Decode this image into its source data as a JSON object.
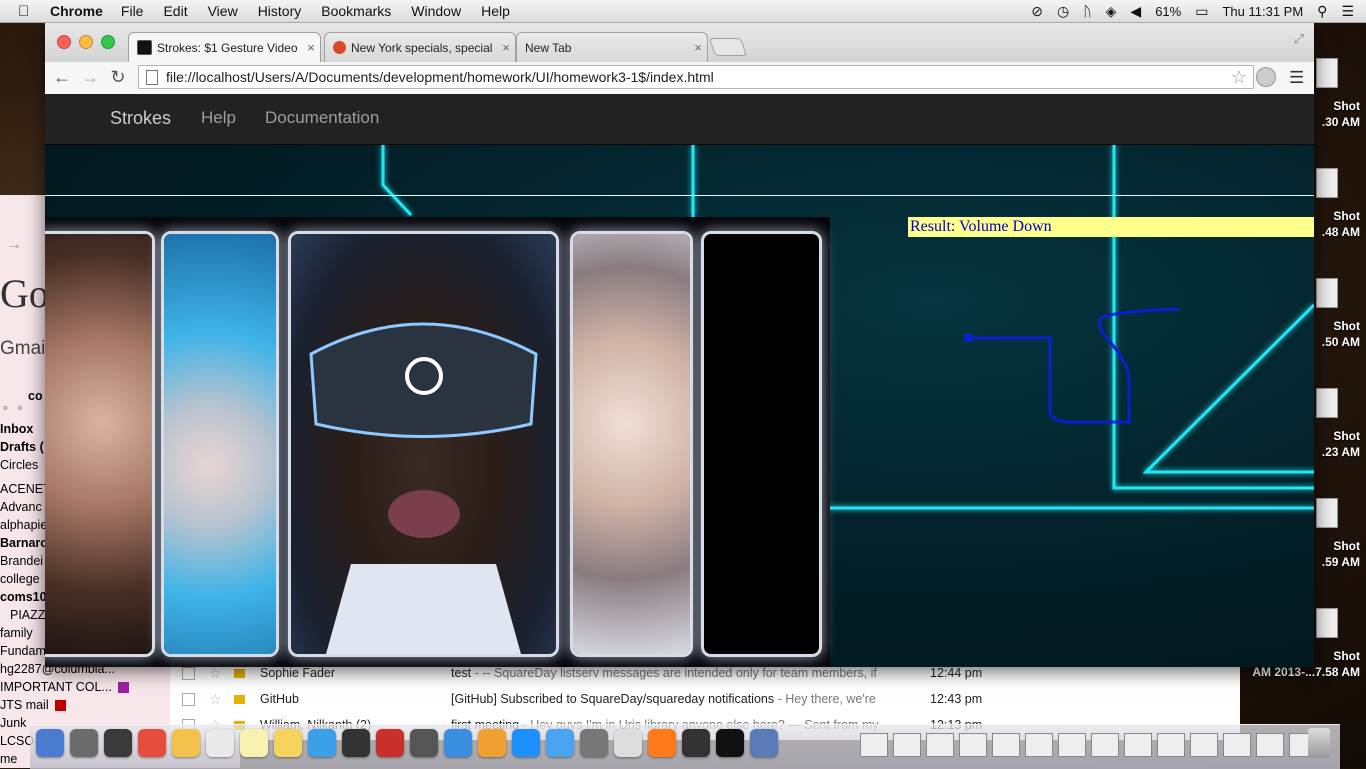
{
  "menubar": {
    "app_name": "Chrome",
    "menus": [
      "File",
      "Edit",
      "View",
      "History",
      "Bookmarks",
      "Window",
      "Help"
    ],
    "battery": "61%",
    "clock": "Thu 11:31 PM"
  },
  "browser": {
    "tabs": [
      {
        "title": "Strokes: $1 Gesture Video",
        "active": true
      },
      {
        "title": "New York specials, special",
        "active": false
      },
      {
        "title": "New Tab",
        "active": false
      }
    ],
    "url": "file://localhost/Users/A/Documents/development/homework/UI/homework3-1$/index.html"
  },
  "app": {
    "brand": "Strokes",
    "nav": [
      "Help",
      "Documentation"
    ],
    "result": "Result: Volume Down"
  },
  "gmail": {
    "logo": "Go",
    "label": "Gmai",
    "compose": "co",
    "folders": [
      {
        "label": "Inbox",
        "bold": true
      },
      {
        "label": "Drafts (",
        "bold": true
      },
      {
        "label": "Circles",
        "bold": false
      },
      {
        "label": "ACENET",
        "bold": false
      },
      {
        "label": "Advanc",
        "bold": false
      },
      {
        "label": "alphapie",
        "bold": false
      },
      {
        "label": "Barnarc",
        "bold": true
      },
      {
        "label": "Brandei",
        "bold": false
      },
      {
        "label": "college",
        "bold": false
      },
      {
        "label": "coms10",
        "bold": true
      },
      {
        "label": "PIAZZ",
        "bold": false
      },
      {
        "label": "family",
        "bold": false
      },
      {
        "label": "Fundam",
        "bold": false
      },
      {
        "label": "hg2287@columbia...",
        "bold": false
      },
      {
        "label": "IMPORTANT COL...",
        "bold": false
      },
      {
        "label": "JTS mail",
        "bold": false
      },
      {
        "label": "Junk",
        "bold": false
      },
      {
        "label": "LCSO",
        "bold": false
      },
      {
        "label": "me",
        "bold": false
      }
    ],
    "emails": [
      {
        "from": "Sophie Fader",
        "subject": "test",
        "snippet": " - -- SquareDay listserv messages are intended only for team members, if",
        "time": "12:44 pm"
      },
      {
        "from": "GitHub",
        "subject": "[GitHub] Subscribed to SquareDay/squareday notifications",
        "snippet": " - Hey there, we're",
        "time": "12:43 pm"
      },
      {
        "from": "William, Nilkanth (2)",
        "subject": "first meeting",
        "snippet": " - Hey guys I'm in Uris library anyone else here? — Sent from my",
        "time": "12:13 pm"
      }
    ]
  },
  "desktop": {
    "screenshots": [
      {
        "name": "Shot",
        "time": ".30 AM"
      },
      {
        "name": "Shot",
        "time": ".48 AM"
      },
      {
        "name": "Shot",
        "time": ".50 AM"
      },
      {
        "name": "Shot",
        "time": ".23 AM"
      },
      {
        "name": "Shot",
        "time": ".59 AM"
      },
      {
        "name": "Shot",
        "time": "AM 2013-...7.58 AM"
      }
    ]
  },
  "colors": {
    "result_bg": "#ffff8c",
    "result_text": "#0000cc",
    "stroke": "#0a1fd0",
    "neon": "#22e6f2",
    "navbar": "#222222"
  }
}
